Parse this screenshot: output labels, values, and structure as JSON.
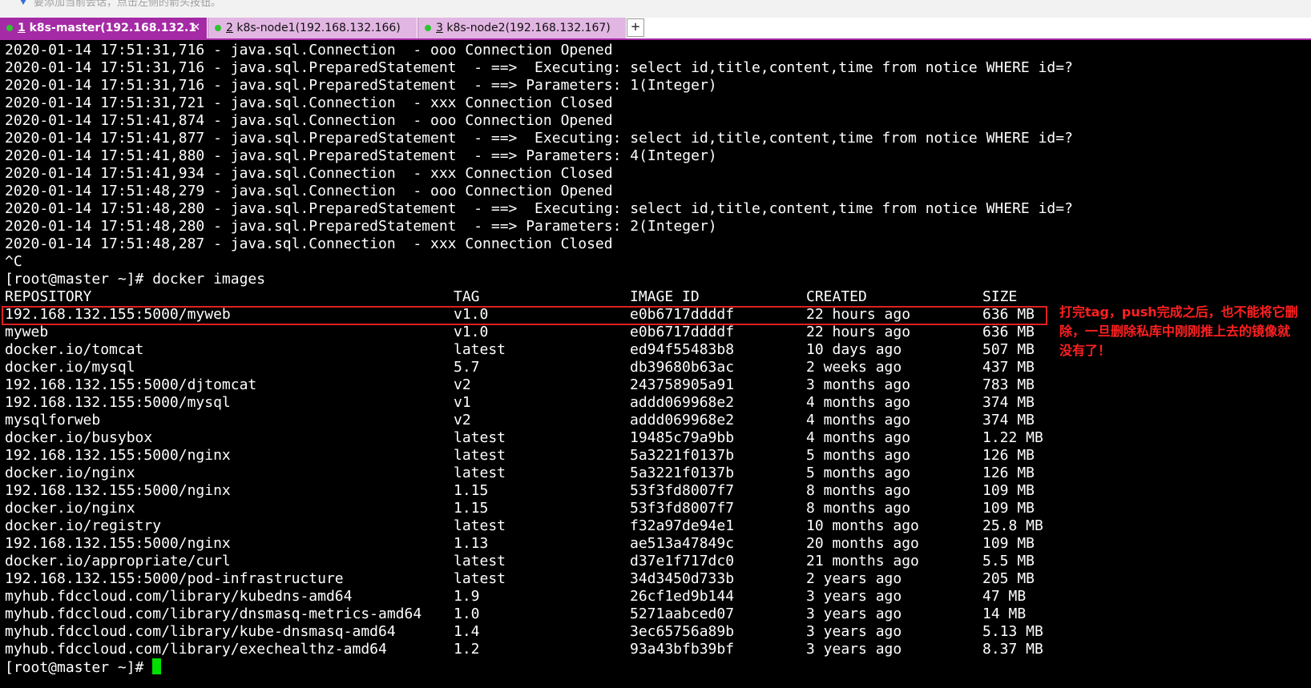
{
  "top_hint": "要添加当前会话，点击左侧的箭头按钮。",
  "tabs": [
    {
      "num": "1",
      "title": " k8s-master(192.168.132.1",
      "active": true
    },
    {
      "num": "2",
      "title": " k8s-node1(192.168.132.166)",
      "active": false
    },
    {
      "num": "3",
      "title": " k8s-node2(192.168.132.167)",
      "active": false
    }
  ],
  "tab_close_glyph": "✕",
  "tab_add_glyph": "+",
  "colors": {
    "tab_active": "#a52aa5",
    "tab_inactive": "#e2b6e2",
    "status_dot": "#2fc52f",
    "cursor": "#00e000",
    "annotation": "#ff2020"
  },
  "log_lines": [
    "2020-01-14 17:51:31,716 - java.sql.Connection  - ooo Connection Opened",
    "2020-01-14 17:51:31,716 - java.sql.PreparedStatement  - ==>  Executing: select id,title,content,time from notice WHERE id=?",
    "2020-01-14 17:51:31,716 - java.sql.PreparedStatement  - ==> Parameters: 1(Integer)",
    "2020-01-14 17:51:31,721 - java.sql.Connection  - xxx Connection Closed",
    "2020-01-14 17:51:41,874 - java.sql.Connection  - ooo Connection Opened",
    "2020-01-14 17:51:41,877 - java.sql.PreparedStatement  - ==>  Executing: select id,title,content,time from notice WHERE id=?",
    "2020-01-14 17:51:41,880 - java.sql.PreparedStatement  - ==> Parameters: 4(Integer)",
    "2020-01-14 17:51:41,934 - java.sql.Connection  - xxx Connection Closed",
    "2020-01-14 17:51:48,279 - java.sql.Connection  - ooo Connection Opened",
    "2020-01-14 17:51:48,280 - java.sql.PreparedStatement  - ==>  Executing: select id,title,content,time from notice WHERE id=?",
    "2020-01-14 17:51:48,280 - java.sql.PreparedStatement  - ==> Parameters: 2(Integer)",
    "2020-01-14 17:51:48,287 - java.sql.Connection  - xxx Connection Closed",
    "^C"
  ],
  "command_line": "[root@master ~]# docker images",
  "table": {
    "headers": [
      "REPOSITORY",
      "TAG",
      "IMAGE ID",
      "CREATED",
      "SIZE"
    ],
    "rows": [
      [
        "192.168.132.155:5000/myweb",
        "v1.0",
        "e0b6717ddddf",
        "22 hours ago",
        "636 MB"
      ],
      [
        "myweb",
        "v1.0",
        "e0b6717ddddf",
        "22 hours ago",
        "636 MB"
      ],
      [
        "docker.io/tomcat",
        "latest",
        "ed94f55483b8",
        "10 days ago",
        "507 MB"
      ],
      [
        "docker.io/mysql",
        "5.7",
        "db39680b63ac",
        "2 weeks ago",
        "437 MB"
      ],
      [
        "192.168.132.155:5000/djtomcat",
        "v2",
        "243758905a91",
        "3 months ago",
        "783 MB"
      ],
      [
        "192.168.132.155:5000/mysql",
        "v1",
        "addd069968e2",
        "4 months ago",
        "374 MB"
      ],
      [
        "mysqlforweb",
        "v2",
        "addd069968e2",
        "4 months ago",
        "374 MB"
      ],
      [
        "docker.io/busybox",
        "latest",
        "19485c79a9bb",
        "4 months ago",
        "1.22 MB"
      ],
      [
        "192.168.132.155:5000/nginx",
        "latest",
        "5a3221f0137b",
        "5 months ago",
        "126 MB"
      ],
      [
        "docker.io/nginx",
        "latest",
        "5a3221f0137b",
        "5 months ago",
        "126 MB"
      ],
      [
        "192.168.132.155:5000/nginx",
        "1.15",
        "53f3fd8007f7",
        "8 months ago",
        "109 MB"
      ],
      [
        "docker.io/nginx",
        "1.15",
        "53f3fd8007f7",
        "8 months ago",
        "109 MB"
      ],
      [
        "docker.io/registry",
        "latest",
        "f32a97de94e1",
        "10 months ago",
        "25.8 MB"
      ],
      [
        "192.168.132.155:5000/nginx",
        "1.13",
        "ae513a47849c",
        "20 months ago",
        "109 MB"
      ],
      [
        "docker.io/appropriate/curl",
        "latest",
        "d37e1f717dc0",
        "21 months ago",
        "5.5 MB"
      ],
      [
        "192.168.132.155:5000/pod-infrastructure",
        "latest",
        "34d3450d733b",
        "2 years ago",
        "205 MB"
      ],
      [
        "myhub.fdccloud.com/library/kubedns-amd64",
        "1.9",
        "26cf1ed9b144",
        "3 years ago",
        "47 MB"
      ],
      [
        "myhub.fdccloud.com/library/dnsmasq-metrics-amd64",
        "1.0",
        "5271aabced07",
        "3 years ago",
        "14 MB"
      ],
      [
        "myhub.fdccloud.com/library/kube-dnsmasq-amd64",
        "1.4",
        "3ec65756a89b",
        "3 years ago",
        "5.13 MB"
      ],
      [
        "myhub.fdccloud.com/library/exechealthz-amd64",
        "1.2",
        "93a43bfb39bf",
        "3 years ago",
        "8.37 MB"
      ]
    ]
  },
  "prompt": "[root@master ~]# ",
  "annotation": "打完tag，push完成之后，也不能将它删除，一旦删除私库中刚刚推上去的镜像就没有了！"
}
